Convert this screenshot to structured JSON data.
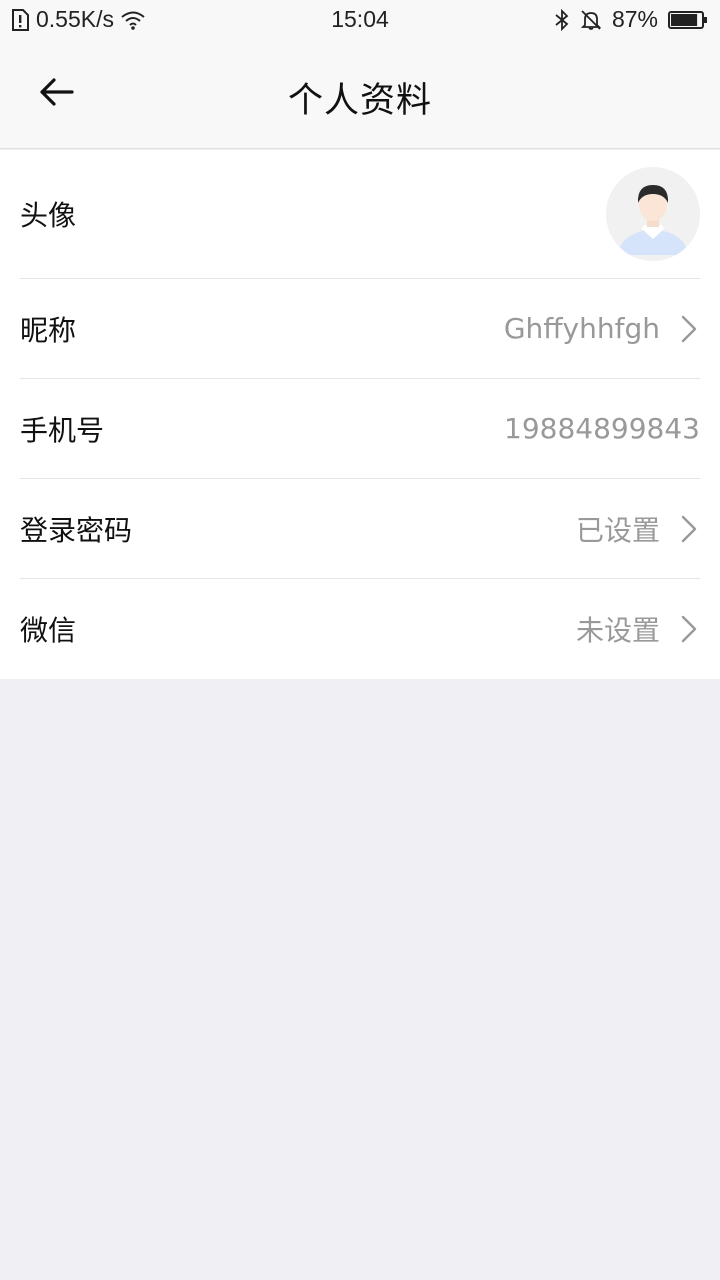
{
  "status_bar": {
    "network_speed": "0.55K/s",
    "time": "15:04",
    "battery_percent": "87%",
    "battery_level": 0.87,
    "icons": [
      "sim-alert-icon",
      "wifi-icon",
      "bluetooth-icon",
      "mute-bell-icon",
      "battery-icon"
    ]
  },
  "nav": {
    "title": "个人资料",
    "back_icon": "back-arrow-icon"
  },
  "profile": {
    "avatar": {
      "label": "头像"
    },
    "nickname": {
      "label": "昵称",
      "value": "Ghffyhhfgh"
    },
    "phone": {
      "label": "手机号",
      "value": "19884899843"
    },
    "password": {
      "label": "登录密码",
      "value": "已设置"
    },
    "wechat": {
      "label": "微信",
      "value": "未设置"
    }
  },
  "colors": {
    "page_background": "#efeff4",
    "nav_background": "#f8f8f8",
    "value_text": "#999999"
  }
}
